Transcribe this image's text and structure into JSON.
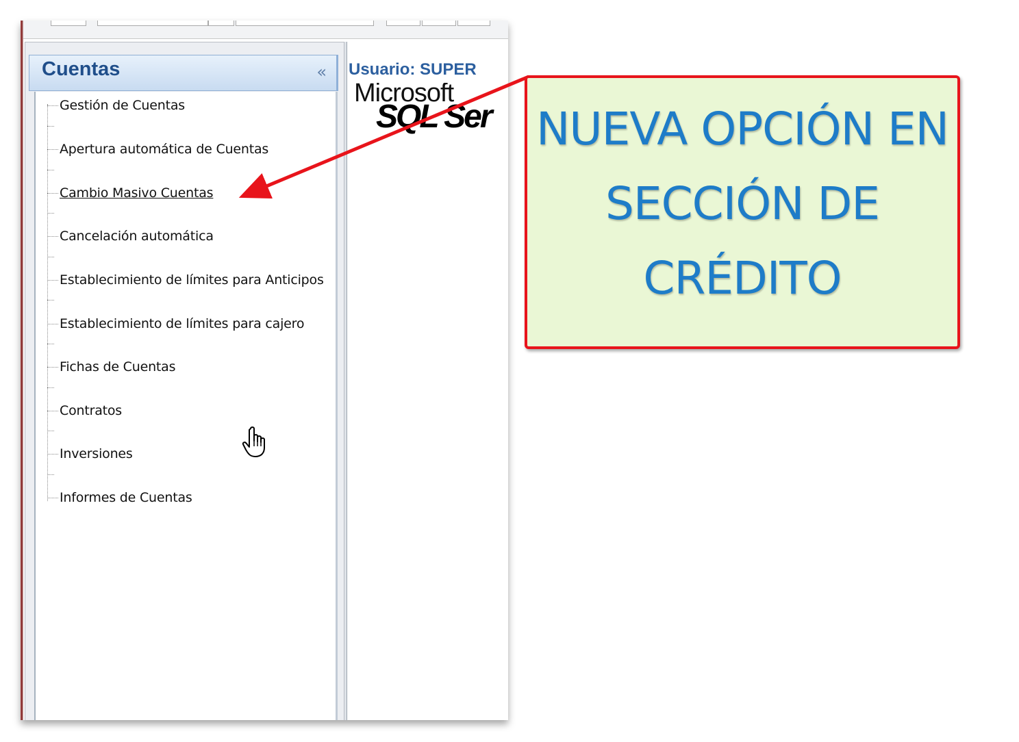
{
  "nav": {
    "title": "Cuentas",
    "collapse_label": "«",
    "items": [
      {
        "label": "Gestión de Cuentas"
      },
      {
        "label": "Apertura automática de Cuentas"
      },
      {
        "label": "Cambio Masivo Cuentas"
      },
      {
        "label": "Cancelación automática"
      },
      {
        "label": "Establecimiento de límites para Anticipos"
      },
      {
        "label": "Establecimiento de límites para cajero"
      },
      {
        "label": "Fichas de Cuentas"
      },
      {
        "label": "Contratos"
      },
      {
        "label": "Inversiones"
      },
      {
        "label": "Informes de Cuentas"
      }
    ]
  },
  "right_pane": {
    "user_label": "Usuario: SUPER",
    "logo_top": "Microsoft",
    "logo_bottom": "SQL Ser"
  },
  "callout": {
    "text": "NUEVA OPCIÓN EN SECCIÓN DE CRÉDITO",
    "border_color": "#e8141b",
    "text_color": "#1e7cc8",
    "background": "#eaf7d5"
  },
  "icons": {
    "cursor": "hand-pointer-icon",
    "arrow": "red-arrow-icon"
  }
}
